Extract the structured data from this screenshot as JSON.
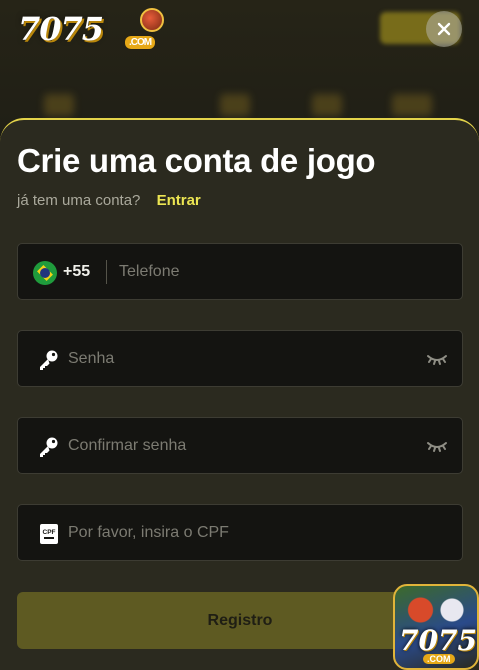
{
  "header": {
    "logo_text": "7075",
    "logo_suffix": ".COM",
    "close_icon": "close-icon"
  },
  "form": {
    "title": "Crie uma conta de jogo",
    "have_account_text": "já tem uma conta?",
    "login_link": "Entrar",
    "phone": {
      "country_flag": "brazil-flag-icon",
      "country_code": "+55",
      "placeholder": "Telefone"
    },
    "password": {
      "icon": "key-icon",
      "placeholder": "Senha",
      "toggle_icon": "eye-closed-icon"
    },
    "confirm_password": {
      "icon": "key-icon",
      "placeholder": "Confirmar senha",
      "toggle_icon": "eye-closed-icon"
    },
    "cpf": {
      "icon": "cpf-icon",
      "icon_label": "CPF",
      "placeholder": "Por favor, insira o CPF"
    },
    "submit_label": "Registro"
  },
  "floating_badge": {
    "logo_text": "7075",
    "logo_suffix": ".COM"
  },
  "colors": {
    "accent": "#ece552",
    "sheet_bg": "#2b2a1f",
    "field_bg": "#141411",
    "button_bg": "#5e5a22"
  }
}
